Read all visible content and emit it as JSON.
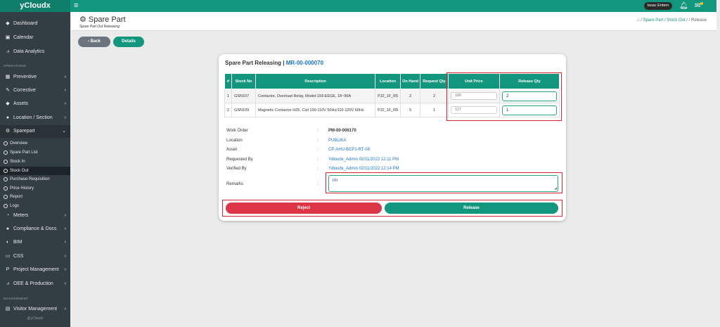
{
  "app": {
    "brand": "yCloudx"
  },
  "topbar": {
    "user": "Issac Entern"
  },
  "sidebar": {
    "items_top": [
      {
        "label": "Dashboard",
        "icon": "dashboard-icon",
        "glyph": "◆"
      },
      {
        "label": "Calendar",
        "icon": "calendar-icon",
        "glyph": "▣"
      },
      {
        "label": "Data Analytics",
        "icon": "analytics-icon",
        "glyph": "⩘"
      }
    ],
    "section_operations": "OPERATIONS",
    "items_ops": [
      {
        "label": "Preventive",
        "icon": "calendar-icon",
        "glyph": "▦"
      },
      {
        "label": "Corrective",
        "icon": "wrench-icon",
        "glyph": "✎"
      },
      {
        "label": "Assets",
        "icon": "tag-icon",
        "glyph": "◆"
      },
      {
        "label": "Location / Section",
        "icon": "location-icon",
        "glyph": "●"
      },
      {
        "label": "Sparepart",
        "icon": "gear-icon",
        "glyph": "⚙"
      }
    ],
    "sparepart_sub": [
      "Overview",
      "Spare Part List",
      "Stock In",
      "Stock Out",
      "Purchase Requisition",
      "Price History",
      "Report",
      "Logs"
    ],
    "items_more": [
      {
        "label": "Meters",
        "icon": "meter-icon",
        "glyph": "◔"
      },
      {
        "label": "Compliance & Docs",
        "icon": "compliance-icon",
        "glyph": "●"
      },
      {
        "label": "BIM",
        "icon": "bim-icon",
        "glyph": "◐"
      },
      {
        "label": "CSS",
        "icon": "css-icon",
        "glyph": "▭"
      },
      {
        "label": "Project Management",
        "icon": "project-icon",
        "glyph": "P"
      },
      {
        "label": "OEE & Production",
        "icon": "oee-icon",
        "glyph": "⩘"
      }
    ],
    "section_management": "MANAGEMENT",
    "items_mgmt": [
      {
        "label": "Visitor Management",
        "icon": "visitor-icon",
        "glyph": "▤"
      }
    ],
    "footer": "@yCloudx"
  },
  "header": {
    "title": "Spare Part",
    "subtitle": "Spare Part Out Releasing",
    "breadcrumb": {
      "sep": "/",
      "a": "Spare Part",
      "b": "Stock Out",
      "c": "Release"
    }
  },
  "actions": {
    "back": "Back",
    "details": "Details"
  },
  "card": {
    "title": "Spare Part Releasing | ",
    "mr_number": "MR-00-000070",
    "columns": [
      "#",
      "Stock No",
      "Description",
      "Location",
      "On Hand",
      "Request Qty",
      "Unit Price",
      "Release Qty"
    ],
    "rows": [
      {
        "no": "1",
        "stock_no": "GSN107",
        "description": "Contactor, Overload Relay, Model:193-EEGE, 18~90A",
        "location": "PJ2_1F_R5",
        "on_hand": "2",
        "request_qty": "2",
        "unit_price": "180",
        "release_qty": "2"
      },
      {
        "no": "2",
        "stock_no": "GSN109",
        "description": "Magnetic Contactor H25, Coil 100-110V 50Hz/110-120V 60Hz",
        "location": "PJ2_1F_R5",
        "on_hand": "5",
        "request_qty": "1",
        "unit_price": "127",
        "release_qty": "1"
      }
    ],
    "info": {
      "colon": ":",
      "work_order_label": "Work Order",
      "work_order": "PM-00-006170",
      "location_label": "Location",
      "location": "PUBLIKA",
      "asset_label": "Asset",
      "asset": "CP-AHU-BCP1-RT-08",
      "requested_label": "Requested By",
      "requested": "Ydloudx_Admin 02/11/2022 12:11 PM",
      "verified_label": "Verified By",
      "verified": "Ydloudx_Admin 02/11/2022 12:14 PM",
      "remarks_label": "Remarks",
      "remarks": "rm"
    },
    "reject": "Reject",
    "release": "Release"
  }
}
